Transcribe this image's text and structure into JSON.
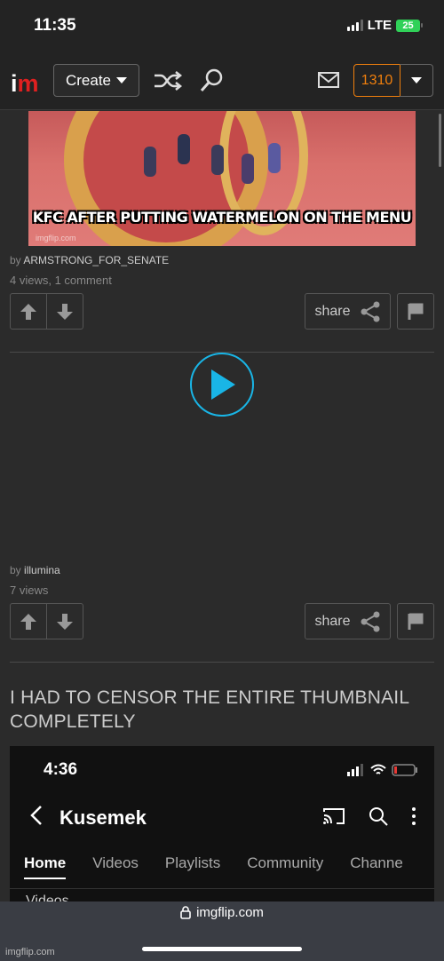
{
  "status": {
    "time": "11:35",
    "network": "LTE",
    "battery": "25"
  },
  "header": {
    "logo_i": "i",
    "logo_m": "m",
    "create_label": "Create",
    "points": "1310"
  },
  "posts": [
    {
      "caption": "KFC AFTER PUTTING WATERMELON ON THE MENU",
      "image_watermark": "imgflip.com",
      "by_prefix": "by",
      "author": "ARMSTRONG_FOR_SENATE",
      "stats": "4 views, 1 comment",
      "share_label": "share"
    },
    {
      "by_prefix": "by",
      "author": "illumina",
      "stats": "7 views",
      "share_label": "share"
    },
    {
      "title": "I HAD TO CENSOR THE ENTIRE THUMBNAIL COMPLETELY",
      "embedded_screenshot": {
        "time": "4:36",
        "channel": "Kusemek",
        "tabs": [
          "Home",
          "Videos",
          "Playlists",
          "Community",
          "Channe"
        ],
        "section": "Videos"
      }
    }
  ],
  "browser": {
    "url": "imgflip.com"
  },
  "watermark": "imgflip.com"
}
